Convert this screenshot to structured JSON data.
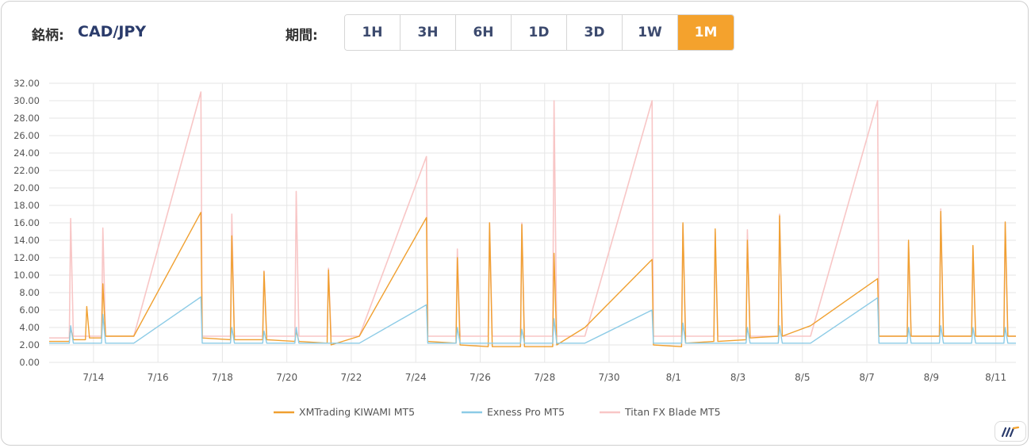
{
  "header": {
    "symbol_label": "銘柄:",
    "symbol_value": "CAD/JPY",
    "period_label": "期間:",
    "periods": [
      "1H",
      "3H",
      "6H",
      "1D",
      "3D",
      "1W",
      "1M"
    ],
    "active_period": "1M"
  },
  "colors": {
    "accent": "#f4a22d"
  },
  "chart_data": {
    "type": "line",
    "title": "",
    "xlabel": "",
    "ylabel": "",
    "ylim": [
      0,
      32
    ],
    "yticks": [
      "0.00",
      "2.00",
      "4.00",
      "6.00",
      "8.00",
      "10.00",
      "12.00",
      "14.00",
      "16.00",
      "18.00",
      "20.00",
      "22.00",
      "24.00",
      "26.00",
      "28.00",
      "30.00",
      "32.00"
    ],
    "xlim": [
      "2025-07-12T15:00",
      "2025-08-11T15:00"
    ],
    "xticks": [
      {
        "label": "7/14",
        "date": "2025-07-14"
      },
      {
        "label": "7/16",
        "date": "2025-07-16"
      },
      {
        "label": "7/18",
        "date": "2025-07-18"
      },
      {
        "label": "7/20",
        "date": "2025-07-20"
      },
      {
        "label": "7/22",
        "date": "2025-07-22"
      },
      {
        "label": "7/24",
        "date": "2025-07-24"
      },
      {
        "label": "7/26",
        "date": "2025-07-26"
      },
      {
        "label": "7/28",
        "date": "2025-07-28"
      },
      {
        "label": "7/30",
        "date": "2025-07-30"
      },
      {
        "label": "8/1",
        "date": "2025-08-01"
      },
      {
        "label": "8/3",
        "date": "2025-08-03"
      },
      {
        "label": "8/5",
        "date": "2025-08-05"
      },
      {
        "label": "8/7",
        "date": "2025-08-07"
      },
      {
        "label": "8/9",
        "date": "2025-08-09"
      },
      {
        "label": "8/11",
        "date": "2025-08-11"
      }
    ],
    "grid": true,
    "legend": "bottom-center",
    "series": [
      {
        "name": "Titan FX Blade MT5",
        "color": "#f8c6c6",
        "points": [
          [
            "2025-07-12T15:00",
            2.8
          ],
          [
            "2025-07-13T06:00",
            2.8
          ],
          [
            "2025-07-13T07:00",
            16.5
          ],
          [
            "2025-07-13T09:00",
            3.0
          ],
          [
            "2025-07-14T06:00",
            3.0
          ],
          [
            "2025-07-14T07:00",
            15.4
          ],
          [
            "2025-07-14T09:00",
            3.0
          ],
          [
            "2025-07-15T06:00",
            3.0
          ],
          [
            "2025-07-17T08:00",
            31.0
          ],
          [
            "2025-07-17T09:00",
            3.0
          ],
          [
            "2025-07-18T06:00",
            3.0
          ],
          [
            "2025-07-18T07:00",
            17.0
          ],
          [
            "2025-07-18T09:00",
            3.0
          ],
          [
            "2025-07-19T06:00",
            3.0
          ],
          [
            "2025-07-19T07:00",
            10.5
          ],
          [
            "2025-07-19T09:00",
            3.0
          ],
          [
            "2025-07-20T06:00",
            3.0
          ],
          [
            "2025-07-20T07:00",
            19.6
          ],
          [
            "2025-07-20T09:00",
            3.0
          ],
          [
            "2025-07-21T06:00",
            3.0
          ],
          [
            "2025-07-21T07:00",
            10.8
          ],
          [
            "2025-07-21T09:00",
            3.0
          ],
          [
            "2025-07-22T06:00",
            3.0
          ],
          [
            "2025-07-24T08:00",
            23.6
          ],
          [
            "2025-07-24T09:00",
            3.0
          ],
          [
            "2025-07-25T06:00",
            3.0
          ],
          [
            "2025-07-25T07:00",
            13.0
          ],
          [
            "2025-07-25T09:00",
            3.0
          ],
          [
            "2025-07-26T06:00",
            3.0
          ],
          [
            "2025-07-26T07:00",
            16.0
          ],
          [
            "2025-07-26T09:00",
            3.0
          ],
          [
            "2025-07-27T06:00",
            3.0
          ],
          [
            "2025-07-27T07:00",
            16.0
          ],
          [
            "2025-07-27T09:00",
            3.0
          ],
          [
            "2025-07-28T06:00",
            3.0
          ],
          [
            "2025-07-28T07:00",
            30.0
          ],
          [
            "2025-07-28T09:00",
            3.0
          ],
          [
            "2025-07-29T06:00",
            3.0
          ],
          [
            "2025-07-31T08:00",
            30.0
          ],
          [
            "2025-07-31T09:00",
            3.0
          ],
          [
            "2025-08-01T06:00",
            3.0
          ],
          [
            "2025-08-01T07:00",
            15.8
          ],
          [
            "2025-08-01T09:00",
            3.0
          ],
          [
            "2025-08-02T06:00",
            3.0
          ],
          [
            "2025-08-02T07:00",
            15.0
          ],
          [
            "2025-08-02T09:00",
            3.0
          ],
          [
            "2025-08-03T06:00",
            3.0
          ],
          [
            "2025-08-03T07:00",
            15.2
          ],
          [
            "2025-08-03T09:00",
            3.0
          ],
          [
            "2025-08-04T06:00",
            3.0
          ],
          [
            "2025-08-04T07:00",
            17.0
          ],
          [
            "2025-08-04T09:00",
            3.0
          ],
          [
            "2025-08-05T06:00",
            3.0
          ],
          [
            "2025-08-07T08:00",
            30.0
          ],
          [
            "2025-08-07T09:00",
            3.0
          ],
          [
            "2025-08-08T06:00",
            3.0
          ],
          [
            "2025-08-08T07:00",
            13.8
          ],
          [
            "2025-08-08T09:00",
            3.0
          ],
          [
            "2025-08-09T06:00",
            3.0
          ],
          [
            "2025-08-09T07:00",
            17.6
          ],
          [
            "2025-08-09T09:00",
            3.0
          ],
          [
            "2025-08-10T06:00",
            3.0
          ],
          [
            "2025-08-10T07:00",
            13.3
          ],
          [
            "2025-08-10T09:00",
            3.0
          ],
          [
            "2025-08-11T06:00",
            3.0
          ],
          [
            "2025-08-11T07:00",
            16.0
          ],
          [
            "2025-08-11T09:00",
            3.0
          ],
          [
            "2025-08-11T15:00",
            3.0
          ]
        ]
      },
      {
        "name": "XMTrading KIWAMI MT5",
        "color": "#f0a030",
        "points": [
          [
            "2025-07-12T15:00",
            2.4
          ],
          [
            "2025-07-13T06:00",
            2.4
          ],
          [
            "2025-07-13T07:00",
            4.0
          ],
          [
            "2025-07-13T09:00",
            2.6
          ],
          [
            "2025-07-13T18:00",
            2.6
          ],
          [
            "2025-07-13T19:00",
            6.4
          ],
          [
            "2025-07-13T21:00",
            2.8
          ],
          [
            "2025-07-14T06:00",
            2.8
          ],
          [
            "2025-07-14T07:00",
            9.0
          ],
          [
            "2025-07-14T09:00",
            3.0
          ],
          [
            "2025-07-15T06:00",
            3.0
          ],
          [
            "2025-07-17T08:00",
            17.2
          ],
          [
            "2025-07-17T09:00",
            2.8
          ],
          [
            "2025-07-18T06:00",
            2.6
          ],
          [
            "2025-07-18T07:00",
            14.5
          ],
          [
            "2025-07-18T09:00",
            2.6
          ],
          [
            "2025-07-19T06:00",
            2.6
          ],
          [
            "2025-07-19T07:00",
            10.4
          ],
          [
            "2025-07-19T09:00",
            2.6
          ],
          [
            "2025-07-20T06:00",
            2.4
          ],
          [
            "2025-07-20T07:00",
            3.6
          ],
          [
            "2025-07-20T09:00",
            2.4
          ],
          [
            "2025-07-21T06:00",
            2.2
          ],
          [
            "2025-07-21T07:00",
            10.6
          ],
          [
            "2025-07-21T09:00",
            2.0
          ],
          [
            "2025-07-22T06:00",
            3.0
          ],
          [
            "2025-07-24T08:00",
            16.6
          ],
          [
            "2025-07-24T09:00",
            2.4
          ],
          [
            "2025-07-25T06:00",
            2.2
          ],
          [
            "2025-07-25T07:00",
            12.0
          ],
          [
            "2025-07-25T09:00",
            2.0
          ],
          [
            "2025-07-26T06:00",
            1.8
          ],
          [
            "2025-07-26T07:00",
            16.0
          ],
          [
            "2025-07-26T09:00",
            1.8
          ],
          [
            "2025-07-27T06:00",
            1.8
          ],
          [
            "2025-07-27T07:00",
            15.8
          ],
          [
            "2025-07-27T09:00",
            1.8
          ],
          [
            "2025-07-28T06:00",
            1.8
          ],
          [
            "2025-07-28T07:00",
            12.5
          ],
          [
            "2025-07-28T09:00",
            2.0
          ],
          [
            "2025-07-29T06:00",
            4.0
          ],
          [
            "2025-07-31T08:00",
            11.8
          ],
          [
            "2025-07-31T09:00",
            2.0
          ],
          [
            "2025-08-01T06:00",
            1.8
          ],
          [
            "2025-08-01T07:00",
            16.0
          ],
          [
            "2025-08-01T09:00",
            2.2
          ],
          [
            "2025-08-02T06:00",
            2.4
          ],
          [
            "2025-08-02T07:00",
            15.3
          ],
          [
            "2025-08-02T09:00",
            2.4
          ],
          [
            "2025-08-03T06:00",
            2.6
          ],
          [
            "2025-08-03T07:00",
            14.0
          ],
          [
            "2025-08-03T09:00",
            2.8
          ],
          [
            "2025-08-04T06:00",
            3.0
          ],
          [
            "2025-08-04T07:00",
            16.8
          ],
          [
            "2025-08-04T09:00",
            3.0
          ],
          [
            "2025-08-05T06:00",
            4.2
          ],
          [
            "2025-08-07T08:00",
            9.6
          ],
          [
            "2025-08-07T09:00",
            3.0
          ],
          [
            "2025-08-08T06:00",
            3.0
          ],
          [
            "2025-08-08T07:00",
            14.0
          ],
          [
            "2025-08-08T09:00",
            3.0
          ],
          [
            "2025-08-09T06:00",
            3.0
          ],
          [
            "2025-08-09T07:00",
            17.3
          ],
          [
            "2025-08-09T09:00",
            3.0
          ],
          [
            "2025-08-10T06:00",
            3.0
          ],
          [
            "2025-08-10T07:00",
            13.4
          ],
          [
            "2025-08-10T09:00",
            3.0
          ],
          [
            "2025-08-11T06:00",
            3.0
          ],
          [
            "2025-08-11T07:00",
            16.1
          ],
          [
            "2025-08-11T09:00",
            3.0
          ],
          [
            "2025-08-11T15:00",
            3.0
          ]
        ]
      },
      {
        "name": "Exness Pro MT5",
        "color": "#8ccbe6",
        "points": [
          [
            "2025-07-12T15:00",
            2.2
          ],
          [
            "2025-07-13T06:00",
            2.2
          ],
          [
            "2025-07-13T07:00",
            4.2
          ],
          [
            "2025-07-13T09:00",
            2.2
          ],
          [
            "2025-07-14T06:00",
            2.2
          ],
          [
            "2025-07-14T07:00",
            5.5
          ],
          [
            "2025-07-14T09:00",
            2.2
          ],
          [
            "2025-07-15T06:00",
            2.2
          ],
          [
            "2025-07-17T08:00",
            7.5
          ],
          [
            "2025-07-17T09:00",
            2.2
          ],
          [
            "2025-07-18T06:00",
            2.2
          ],
          [
            "2025-07-18T07:00",
            4.0
          ],
          [
            "2025-07-18T09:00",
            2.2
          ],
          [
            "2025-07-19T06:00",
            2.2
          ],
          [
            "2025-07-19T07:00",
            3.6
          ],
          [
            "2025-07-19T09:00",
            2.2
          ],
          [
            "2025-07-20T06:00",
            2.2
          ],
          [
            "2025-07-20T07:00",
            4.0
          ],
          [
            "2025-07-20T09:00",
            2.2
          ],
          [
            "2025-07-22T06:00",
            2.2
          ],
          [
            "2025-07-24T08:00",
            6.6
          ],
          [
            "2025-07-24T09:00",
            2.2
          ],
          [
            "2025-07-25T06:00",
            2.2
          ],
          [
            "2025-07-25T07:00",
            4.0
          ],
          [
            "2025-07-25T09:00",
            2.2
          ],
          [
            "2025-07-27T06:00",
            2.2
          ],
          [
            "2025-07-27T07:00",
            3.8
          ],
          [
            "2025-07-27T09:00",
            2.2
          ],
          [
            "2025-07-28T06:00",
            2.2
          ],
          [
            "2025-07-28T07:00",
            5.0
          ],
          [
            "2025-07-28T09:00",
            2.2
          ],
          [
            "2025-07-29T06:00",
            2.2
          ],
          [
            "2025-07-31T08:00",
            6.0
          ],
          [
            "2025-07-31T09:00",
            2.2
          ],
          [
            "2025-08-01T06:00",
            2.2
          ],
          [
            "2025-08-01T07:00",
            4.5
          ],
          [
            "2025-08-01T09:00",
            2.2
          ],
          [
            "2025-08-03T06:00",
            2.2
          ],
          [
            "2025-08-03T07:00",
            4.0
          ],
          [
            "2025-08-03T09:00",
            2.2
          ],
          [
            "2025-08-04T06:00",
            2.2
          ],
          [
            "2025-08-04T07:00",
            4.2
          ],
          [
            "2025-08-04T09:00",
            2.2
          ],
          [
            "2025-08-05T06:00",
            2.2
          ],
          [
            "2025-08-07T08:00",
            7.4
          ],
          [
            "2025-08-07T09:00",
            2.2
          ],
          [
            "2025-08-08T06:00",
            2.2
          ],
          [
            "2025-08-08T07:00",
            4.0
          ],
          [
            "2025-08-08T09:00",
            2.2
          ],
          [
            "2025-08-09T06:00",
            2.2
          ],
          [
            "2025-08-09T07:00",
            4.2
          ],
          [
            "2025-08-09T09:00",
            2.2
          ],
          [
            "2025-08-10T06:00",
            2.2
          ],
          [
            "2025-08-10T07:00",
            4.0
          ],
          [
            "2025-08-10T09:00",
            2.2
          ],
          [
            "2025-08-11T06:00",
            2.2
          ],
          [
            "2025-08-11T07:00",
            4.0
          ],
          [
            "2025-08-11T09:00",
            2.2
          ],
          [
            "2025-08-11T15:00",
            2.2
          ]
        ]
      }
    ],
    "legend_order": [
      "XMTrading KIWAMI MT5",
      "Exness Pro MT5",
      "Titan FX Blade MT5"
    ]
  }
}
